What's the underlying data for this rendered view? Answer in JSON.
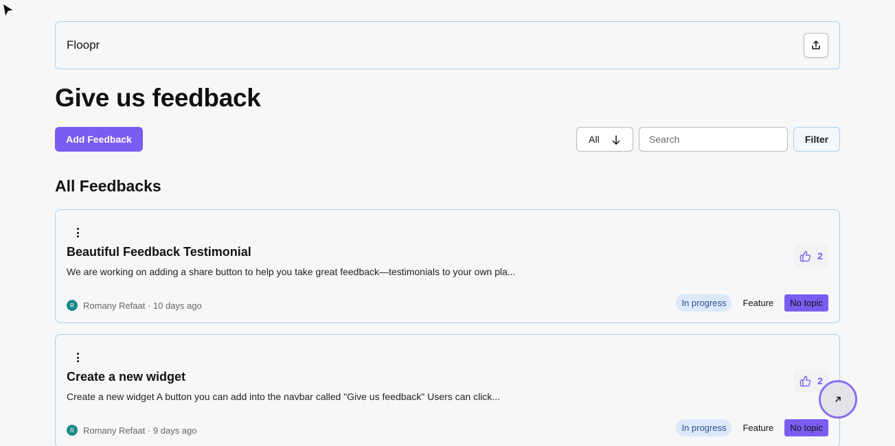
{
  "header": {
    "brand": "Floopr",
    "share_icon": "share-upload-icon"
  },
  "page": {
    "title": "Give us feedback",
    "add_button_label": "Add Feedback"
  },
  "controls": {
    "sort_value": "All",
    "sort_icon": "arrow-down-icon",
    "search_placeholder": "Search",
    "filter_label": "Filter"
  },
  "section": {
    "title": "All Feedbacks"
  },
  "feedbacks": [
    {
      "title": "Beautiful Feedback Testimonial",
      "description": "We are working on adding a share button to help you take great feedback—testimonials to your own pla...",
      "votes": "2",
      "author_initial": "R",
      "author": "Romany Refaat",
      "time": "10 days ago",
      "status": "In progress",
      "type": "Feature",
      "topic": "No topic"
    },
    {
      "title": "Create a new widget",
      "description": "Create a new widget A button you can add into the navbar called \"Give us feedback\" Users can click...",
      "votes": "2",
      "author_initial": "R",
      "author": "Romany Refaat",
      "time": "9 days ago",
      "status": "In progress",
      "type": "Feature",
      "topic": "No topic"
    }
  ],
  "colors": {
    "accent": "#7b5cf0",
    "border": "#a9cdf0",
    "status_bg": "#dbe9fb"
  }
}
